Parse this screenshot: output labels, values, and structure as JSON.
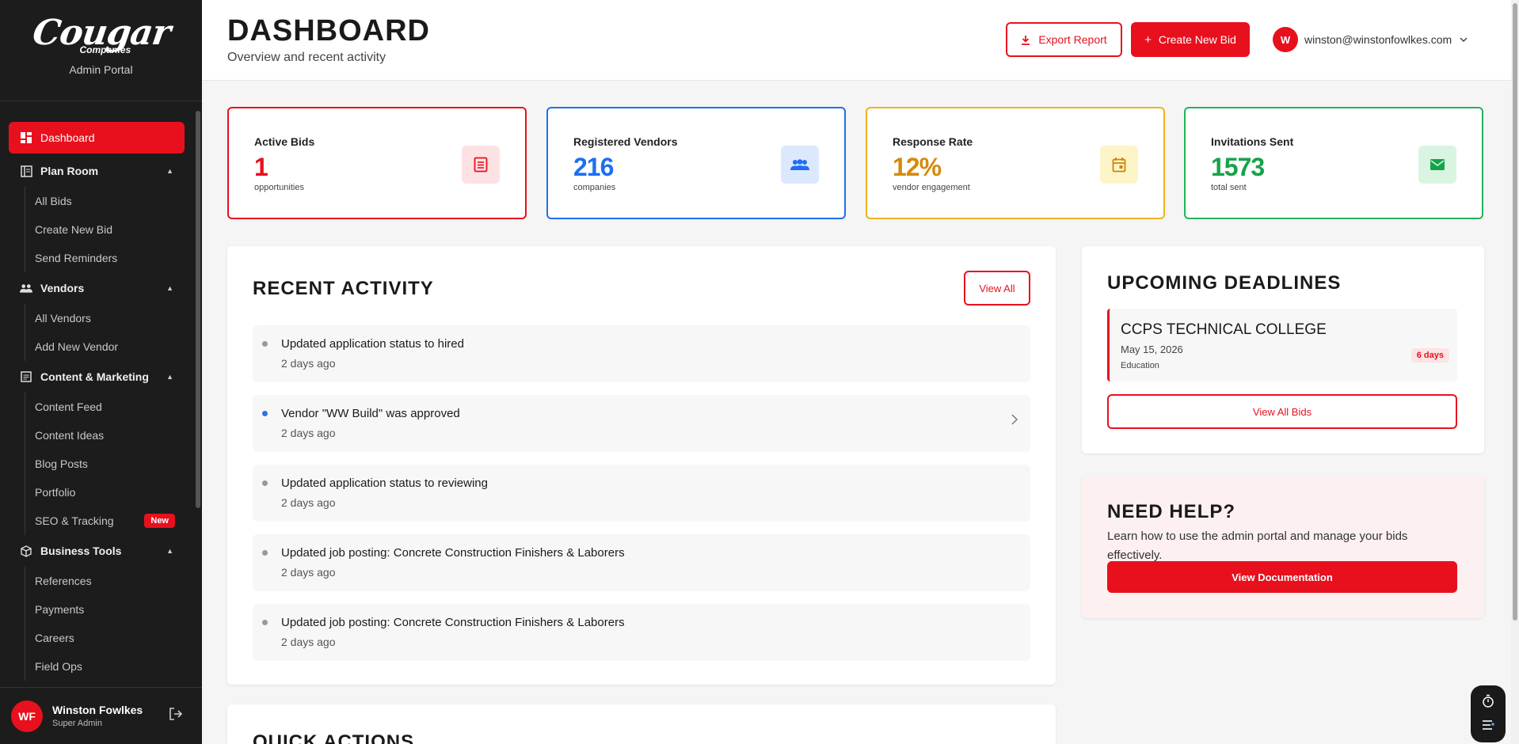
{
  "sidebar": {
    "brand": {
      "logo_word": "Cougar",
      "logo_sub": "Companies",
      "portal": "Admin Portal"
    },
    "active_item": "Dashboard",
    "sections": [
      {
        "label": "Plan Room",
        "items": [
          "All Bids",
          "Create New Bid",
          "Send Reminders"
        ]
      },
      {
        "label": "Vendors",
        "items": [
          "All Vendors",
          "Add New Vendor"
        ]
      },
      {
        "label": "Content & Marketing",
        "items": [
          "Content Feed",
          "Content Ideas",
          "Blog Posts",
          "Portfolio",
          "SEO & Tracking"
        ],
        "badge": "New"
      },
      {
        "label": "Business Tools",
        "items": [
          "References",
          "Payments",
          "Careers",
          "Field Ops"
        ]
      }
    ],
    "user": {
      "initials": "WF",
      "name": "Winston Fowlkes",
      "role": "Super Admin"
    }
  },
  "header": {
    "title": "DASHBOARD",
    "subtitle": "Overview and recent activity",
    "export_label": "Export Report",
    "create_label": "Create New Bid",
    "user_initial": "W",
    "user_email": "winston@winstonfowlkes.com"
  },
  "stats": [
    {
      "label": "Active Bids",
      "value": "1",
      "unit": "opportunities",
      "color": "#e8101d"
    },
    {
      "label": "Registered Vendors",
      "value": "216",
      "unit": "companies",
      "color": "#1e6ff0"
    },
    {
      "label": "Response Rate",
      "value": "12%",
      "unit": "vendor engagement",
      "color": "#d48a0a"
    },
    {
      "label": "Invitations Sent",
      "value": "1573",
      "unit": "total sent",
      "color": "#16a34a"
    }
  ],
  "recent_activity": {
    "title": "RECENT ACTIVITY",
    "view_all": "View All",
    "items": [
      {
        "title": "Updated application status to hired",
        "time": "2 days ago"
      },
      {
        "title": "Vendor \"WW Build\" was approved",
        "time": "2 days ago"
      },
      {
        "title": "Updated application status to reviewing",
        "time": "2 days ago"
      },
      {
        "title": "Updated job posting: Concrete Construction Finishers & Laborers",
        "time": "2 days ago"
      },
      {
        "title": "Updated job posting: Concrete Construction Finishers & Laborers",
        "time": "2 days ago"
      }
    ]
  },
  "quick_actions": {
    "title": "QUICK ACTIONS"
  },
  "deadlines": {
    "title": "UPCOMING DEADLINES",
    "items": [
      {
        "title": "CCPS TECHNICAL COLLEGE",
        "date": "May 15, 2026",
        "category": "Education",
        "badge": "6 days"
      }
    ],
    "view_all": "View All Bids"
  },
  "help": {
    "title": "NEED HELP?",
    "text": "Learn how to use the admin portal and manage your bids effectively.",
    "button": "View Documentation"
  },
  "colors": {
    "accent": "#e8101d",
    "sidebar_bg": "#1c1c1c"
  }
}
